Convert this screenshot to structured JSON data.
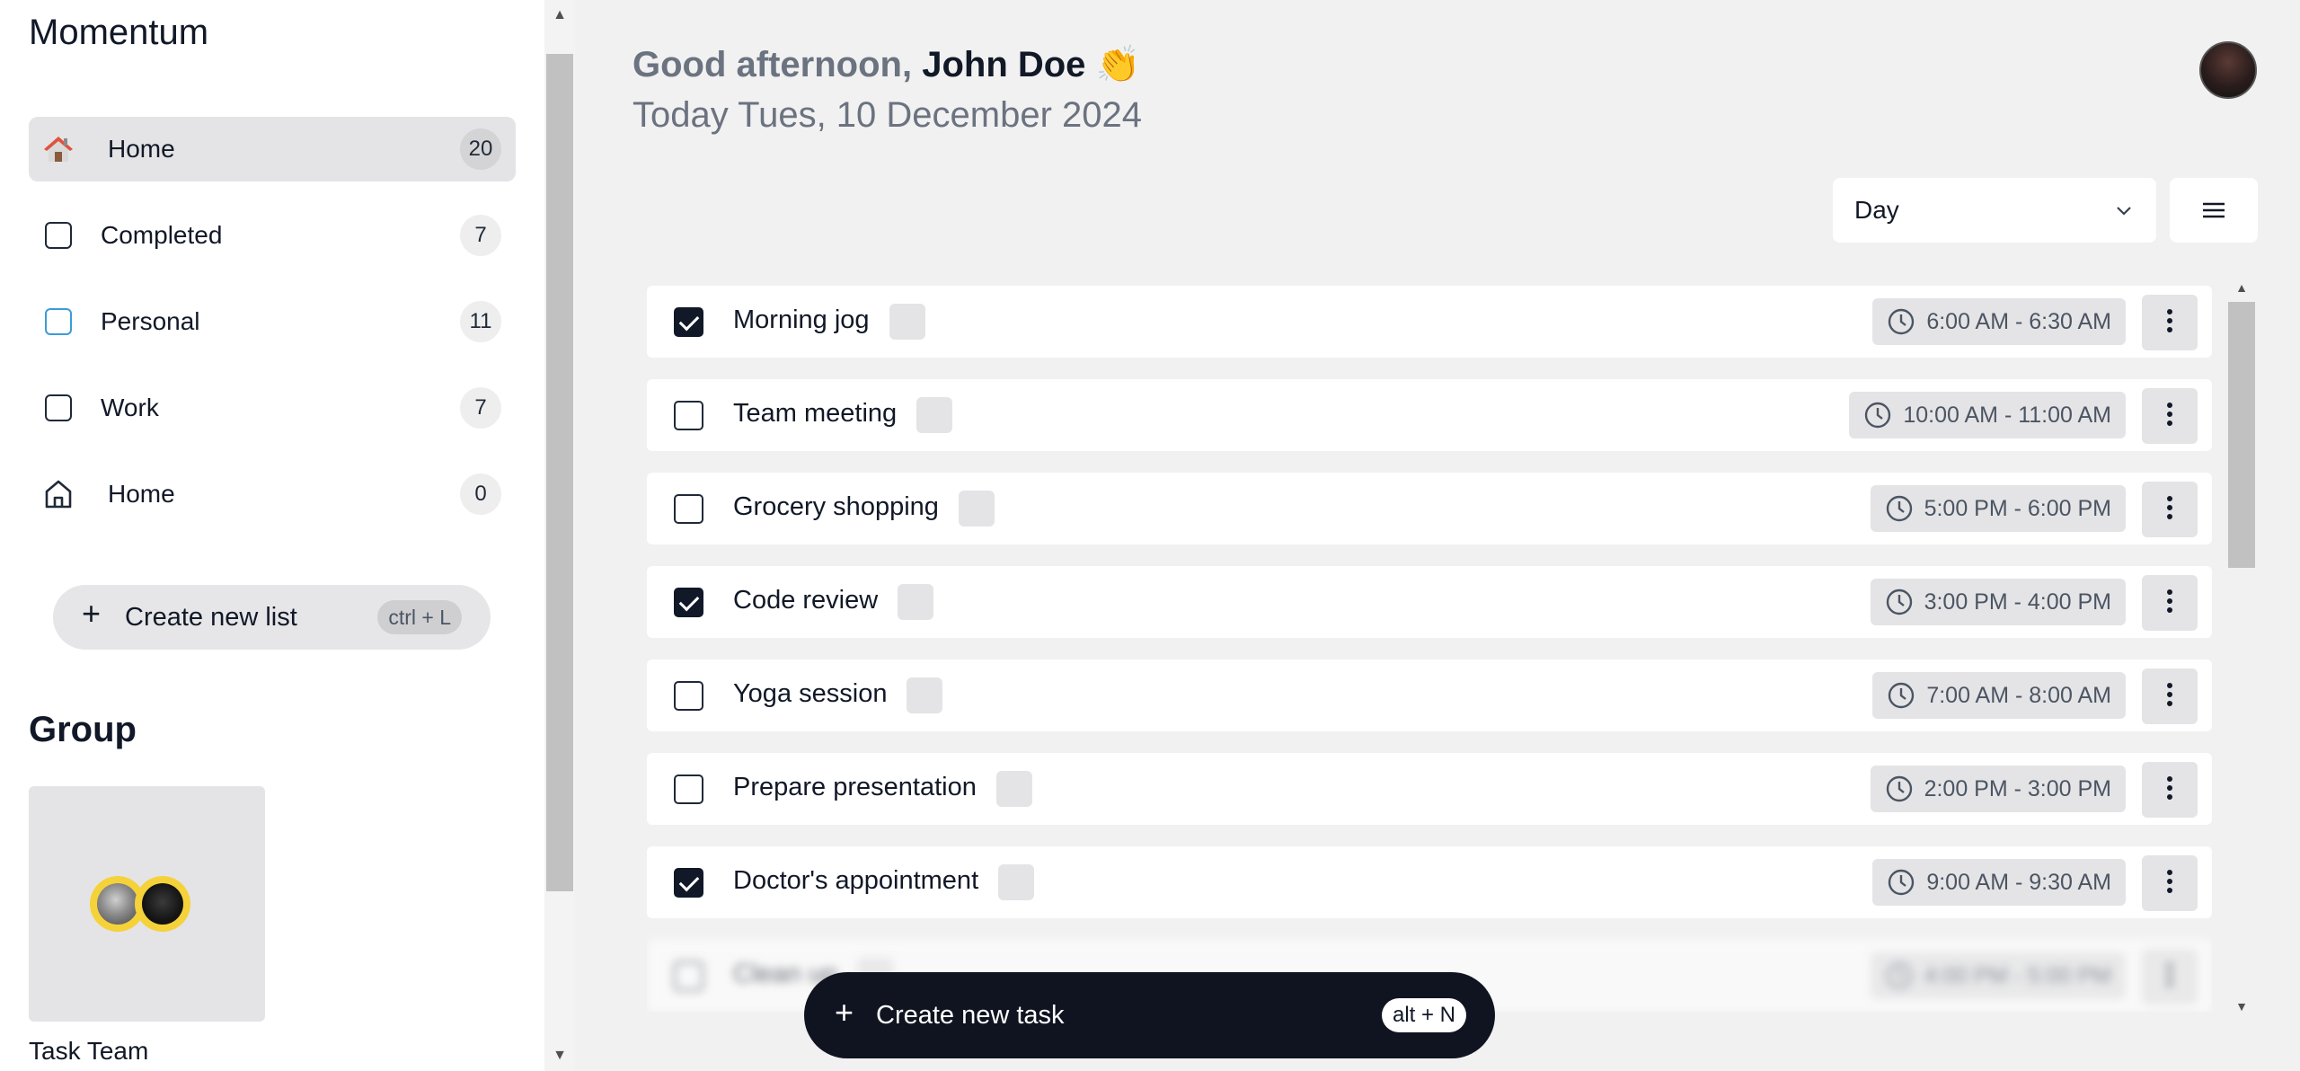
{
  "app": {
    "title": "Momentum"
  },
  "sidebar": {
    "items": [
      {
        "label": "Home",
        "count": "20",
        "icon": "house-color-icon",
        "active": true
      },
      {
        "label": "Completed",
        "count": "7",
        "icon": "checkbox-icon"
      },
      {
        "label": "Personal",
        "count": "11",
        "icon": "checkbox-blue-icon",
        "color": "#3b9bd9"
      },
      {
        "label": "Work",
        "count": "7",
        "icon": "checkbox-icon"
      },
      {
        "label": "Home",
        "count": "0",
        "icon": "house-outline-icon"
      }
    ],
    "create_list": {
      "label": "Create new list",
      "shortcut": "ctrl + L"
    },
    "group": {
      "title": "Group",
      "card_name": "Task Team"
    }
  },
  "header": {
    "greeting_prefix": "Good afternoon,",
    "user_name": "John Doe",
    "greeting_emoji": "👏",
    "date": "Today Tues, 10 December 2024"
  },
  "controls": {
    "view": "Day"
  },
  "tasks": [
    {
      "title": "Morning jog",
      "time": "6:00 AM - 6:30 AM",
      "done": true
    },
    {
      "title": "Team meeting",
      "time": "10:00 AM - 11:00 AM",
      "done": false
    },
    {
      "title": "Grocery shopping",
      "time": "5:00 PM - 6:00 PM",
      "done": false
    },
    {
      "title": "Code review",
      "time": "3:00 PM - 4:00 PM",
      "done": true
    },
    {
      "title": "Yoga session",
      "time": "7:00 AM - 8:00 AM",
      "done": false
    },
    {
      "title": "Prepare presentation",
      "time": "2:00 PM - 3:00 PM",
      "done": false
    },
    {
      "title": "Doctor's appointment",
      "time": "9:00 AM - 9:30 AM",
      "done": true
    },
    {
      "title": "Clean up",
      "time": "4:00 PM - 5:00 PM",
      "done": false
    }
  ],
  "create_task": {
    "label": "Create new task",
    "shortcut": "alt + N"
  },
  "colors": {
    "accent_dark": "#0f1420",
    "active_bg": "#e4e4e6",
    "blue_list": "#3b9bd9",
    "avatar_ring": "#f5d23a"
  }
}
